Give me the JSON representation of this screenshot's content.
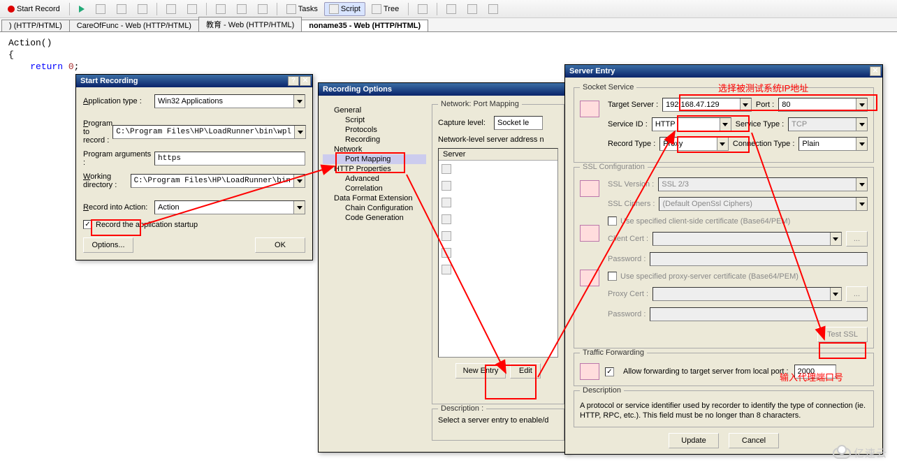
{
  "toolbar": {
    "start_record": "Start Record",
    "tasks": "Tasks",
    "script": "Script",
    "tree": "Tree"
  },
  "tabs": [
    ") (HTTP/HTML)",
    "CareOfFunc - Web (HTTP/HTML)",
    "教育 - Web (HTTP/HTML)",
    "noname35 - Web (HTTP/HTML)"
  ],
  "code": {
    "line1": "Action()",
    "line2": "{",
    "line3_kw": "return",
    "line3_num": "0",
    "line3_end": ";",
    "line4": "}"
  },
  "start_recording": {
    "title": "Start Recording",
    "app_type_label": "Application type :",
    "app_type_value": "Win32 Applications",
    "program_label": "Program to record :",
    "program_value": "C:\\Program Files\\HP\\LoadRunner\\bin\\wpl",
    "args_label": "Program arguments :",
    "args_value": "https",
    "workdir_label": "Working directory :",
    "workdir_value": "C:\\Program Files\\HP\\LoadRunner\\bin",
    "record_into_label": "Record into Action:",
    "record_into_value": "Action",
    "record_startup": "Record the application startup",
    "options_btn": "Options...",
    "ok_btn": "OK"
  },
  "recording_options": {
    "title": "Recording Options",
    "tree": {
      "general": "General",
      "script": "Script",
      "protocols": "Protocols",
      "recording": "Recording",
      "network": "Network",
      "port_mapping": "Port Mapping",
      "http": "HTTP Properties",
      "advanced": "Advanced",
      "correlation": "Correlation",
      "dfe": "Data Format Extension",
      "chain": "Chain Configuration",
      "codegen": "Code Generation"
    },
    "panel": {
      "heading": "Network: Port Mapping",
      "capture_level_label": "Capture level:",
      "capture_level_value": "Socket le",
      "nls_label": "Network-level server address n",
      "server_col": "Server",
      "new_entry": "New Entry",
      "edit": "Edit",
      "desc_label": "Description :",
      "desc_text": "Select a server entry to enable/d"
    }
  },
  "server_entry": {
    "title": "Server Entry",
    "socket_service": "Socket Service",
    "target_server_label": "Target Server :",
    "target_server_value": "192.168.47.129",
    "port_label": "Port :",
    "port_value": "80",
    "service_id_label": "Service ID :",
    "service_id_value": "HTTP",
    "service_type_label": "Service Type :",
    "service_type_value": "TCP",
    "record_type_label": "Record Type :",
    "record_type_value": "Proxy",
    "conn_type_label": "Connection Type :",
    "conn_type_value": "Plain",
    "ssl_config": "SSL Configuration",
    "ssl_version_label": "SSL Version :",
    "ssl_version_value": "SSL 2/3",
    "ssl_ciphers_label": "SSL Ciphers :",
    "ssl_ciphers_value": "(Default OpenSsl Ciphers)",
    "client_cert_chk": "Use specified client-side certificate (Base64/PEM)",
    "client_cert_label": "Client Cert :",
    "client_pw_label": "Password :",
    "proxy_cert_chk": "Use specified proxy-server certificate (Base64/PEM)",
    "proxy_cert_label": "Proxy Cert :",
    "proxy_pw_label": "Password :",
    "test_ssl": "Test SSL",
    "traffic_forwarding": "Traffic Forwarding",
    "allow_fwd": "Allow forwarding to target server from local port :",
    "local_port": "2000",
    "desc_label": "Description",
    "desc_text": "A protocol or service identifier used by recorder to identify the type of connection (ie. HTTP, RPC, etc.).  This field must be no longer than 8 characters.",
    "update": "Update",
    "cancel": "Cancel"
  },
  "annotations": {
    "ip_note": "选择被测试系统IP地址",
    "port_note": "输入代理端口号"
  },
  "watermark": "亿速云"
}
